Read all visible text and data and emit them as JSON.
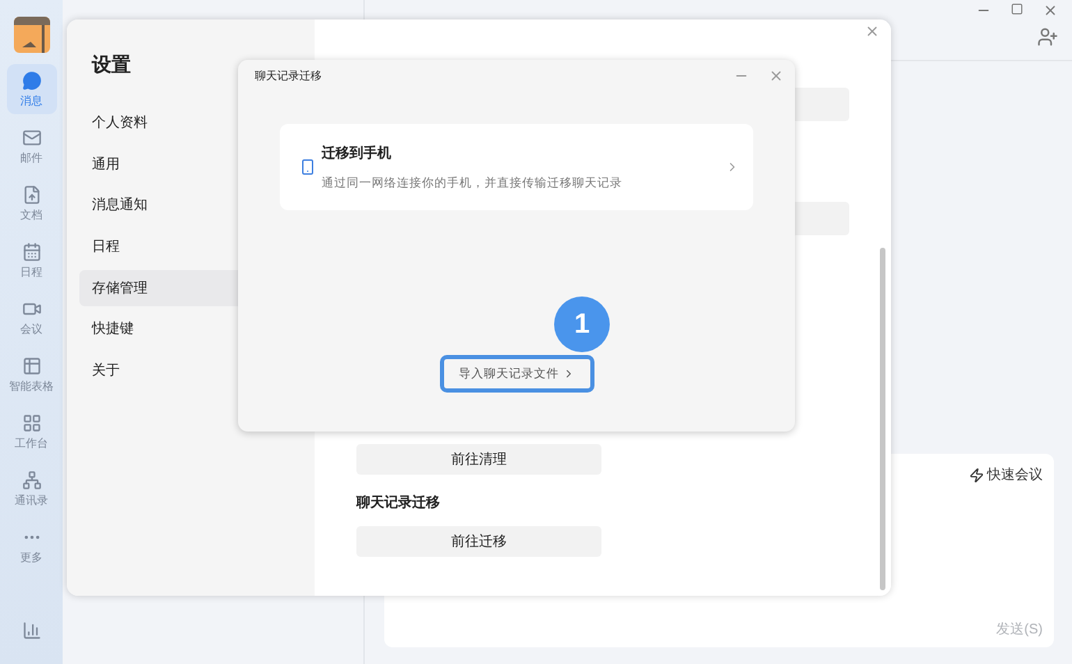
{
  "app_sidebar": {
    "items": [
      {
        "label": "消息",
        "selected": true
      },
      {
        "label": "邮件",
        "selected": false
      },
      {
        "label": "文档",
        "selected": false
      },
      {
        "label": "日程",
        "selected": false
      },
      {
        "label": "会议",
        "selected": false
      },
      {
        "label": "智能表格",
        "selected": false
      },
      {
        "label": "工作台",
        "selected": false
      },
      {
        "label": "通讯录",
        "selected": false
      },
      {
        "label": "更多",
        "selected": false
      }
    ]
  },
  "chat_input": {
    "quick_meeting": "快速会议",
    "send": "发送(S)"
  },
  "settings": {
    "title": "设置",
    "nav": [
      {
        "label": "个人资料",
        "selected": false
      },
      {
        "label": "通用",
        "selected": false
      },
      {
        "label": "消息通知",
        "selected": false
      },
      {
        "label": "日程",
        "selected": false
      },
      {
        "label": "存储管理",
        "selected": true
      },
      {
        "label": "快捷键",
        "selected": false
      },
      {
        "label": "关于",
        "selected": false
      }
    ],
    "content": {
      "clean_button": "前往清理",
      "migration_heading": "聊天记录迁移",
      "migrate_button": "前往迁移"
    }
  },
  "migration_dialog": {
    "title": "聊天记录迁移",
    "option": {
      "title": "迁移到手机",
      "description": "通过同一网络连接你的手机，并直接传输迁移聊天记录"
    },
    "import_button": "导入聊天记录文件"
  },
  "step_marker": "1"
}
